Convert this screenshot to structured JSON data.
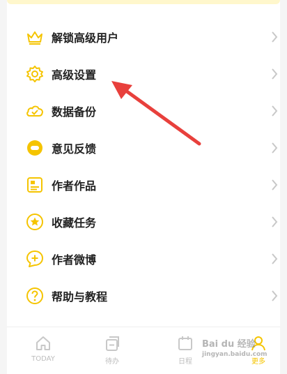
{
  "menu": {
    "items": [
      {
        "label": "解锁高级用户",
        "icon": "crown-icon"
      },
      {
        "label": "高级设置",
        "icon": "gear-icon"
      },
      {
        "label": "数据备份",
        "icon": "cloud-check-icon"
      },
      {
        "label": "意见反馈",
        "icon": "feedback-bubble-icon"
      },
      {
        "label": "作者作品",
        "icon": "portfolio-card-icon"
      },
      {
        "label": "收藏任务",
        "icon": "star-icon"
      },
      {
        "label": "作者微博",
        "icon": "weibo-plus-icon"
      },
      {
        "label": "帮助与教程",
        "icon": "help-icon"
      }
    ]
  },
  "tabbar": {
    "tabs": [
      {
        "label": "TODAY",
        "icon": "home-icon"
      },
      {
        "label": "待办",
        "icon": "todo-icon"
      },
      {
        "label": "日程",
        "icon": "calendar-icon"
      },
      {
        "label": "更多",
        "icon": "user-icon",
        "active": true
      }
    ]
  },
  "watermark": {
    "brand": "Bai du 经验",
    "url": "jingyan.baidu.com"
  },
  "colors": {
    "accent": "#f5c400",
    "arrow": "#e8403c",
    "inactive": "#bdbdbd"
  }
}
